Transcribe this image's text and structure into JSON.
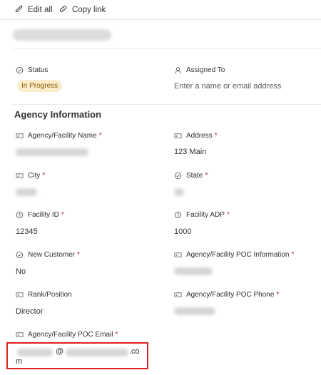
{
  "toolbar": {
    "edit_all": "Edit all",
    "copy_link": "Copy link"
  },
  "status": {
    "label": "Status",
    "value": "In Progress",
    "badge_bg": "#fbeccb",
    "badge_fg": "#8a5a00"
  },
  "assigned_to": {
    "label": "Assigned To",
    "placeholder": "Enter a name or email address"
  },
  "section": {
    "title": "Agency Information"
  },
  "fields": {
    "agency_name": {
      "label": "Agency/Facility Name",
      "required": "*",
      "icon": "text-field-icon"
    },
    "address": {
      "label": "Address",
      "required": "*",
      "icon": "text-field-icon",
      "value": "123 Main"
    },
    "city": {
      "label": "City",
      "required": "*",
      "icon": "text-field-icon"
    },
    "state": {
      "label": "State",
      "required": "*",
      "icon": "choice-icon"
    },
    "facility_id": {
      "label": "Facility ID",
      "required": "*",
      "icon": "number-icon",
      "value": "12345"
    },
    "facility_adp": {
      "label": "Facility ADP",
      "required": "*",
      "icon": "number-icon",
      "value": "1000"
    },
    "new_customer": {
      "label": "New Customer",
      "required": "*",
      "icon": "choice-icon",
      "value": "No"
    },
    "poc_info": {
      "label": "Agency/Facility POC Information",
      "required": "*",
      "icon": "text-field-icon"
    },
    "rank": {
      "label": "Rank/Position",
      "icon": "text-field-icon",
      "value": "Director"
    },
    "poc_phone": {
      "label": "Agency/Facility POC Phone",
      "required": "*",
      "icon": "text-field-icon"
    },
    "poc_email": {
      "label": "Agency/Facility POC Email",
      "required": "*",
      "icon": "text-field-icon",
      "value_at": "@",
      "value_tail_1": ".co",
      "value_tail_2": "m"
    }
  },
  "colors": {
    "highlight": "#e02020",
    "required": "#a4262c"
  }
}
